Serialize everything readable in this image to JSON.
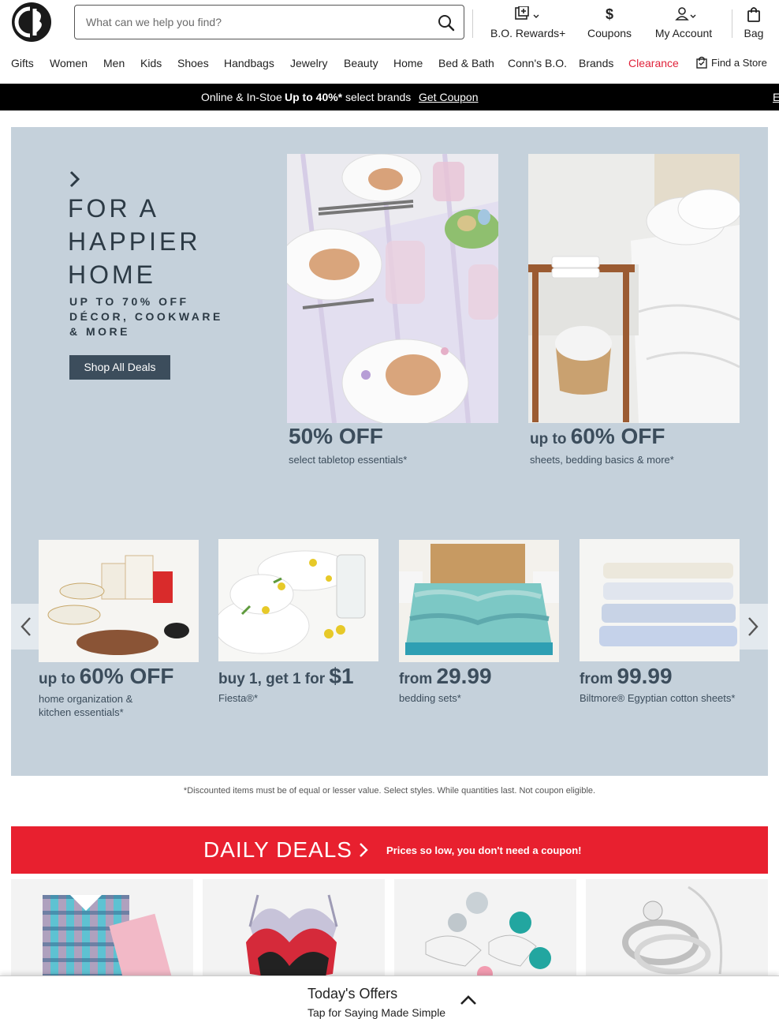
{
  "header": {
    "search_placeholder": "What can we help you find?",
    "rewards_label": "B.O. Rewards+",
    "coupons_label": "Coupons",
    "account_label": "My Account",
    "bag_label": "Bag"
  },
  "nav": {
    "items": [
      "Gifts",
      "Women",
      "Men",
      "Kids",
      "Shoes",
      "Handbags",
      "Jewelry",
      "Beauty",
      "Home",
      "Bed & Bath",
      "Conn's B.O.",
      "Brands",
      "Clearance"
    ],
    "find_store": "Find a Store"
  },
  "promo": {
    "text1": "Online & In-Stoe",
    "bold": "Up to 40%*",
    "text2": "select brands",
    "link": "Get Coupon",
    "edge": "E"
  },
  "hero": {
    "title": [
      "FOR A",
      "HAPPIER",
      "HOME"
    ],
    "subtitle": [
      "UP TO 70% OFF",
      "DÉCOR, COOKWARE",
      "& MORE"
    ],
    "cta": "Shop All Deals",
    "features": [
      {
        "prefix": "",
        "big": "50% OFF",
        "caption": "select tabletop essentials*"
      },
      {
        "prefix": "up to ",
        "big": "60% OFF",
        "caption": "sheets, bedding basics & more*"
      }
    ],
    "tiles": [
      {
        "prefix": "up to ",
        "big": "60% OFF",
        "caption": [
          "home organization &",
          "kitchen essentials*"
        ]
      },
      {
        "prefix": "buy 1, get 1 for ",
        "big": "$1",
        "caption": [
          "Fiesta®*"
        ]
      },
      {
        "prefix": "from ",
        "big": "29.99",
        "caption": [
          "bedding sets*"
        ]
      },
      {
        "prefix": "from ",
        "big": "99.99",
        "caption": [
          "Biltmore® Egyptian cotton sheets*"
        ]
      }
    ]
  },
  "disclaimer": "*Discounted items must be of equal or lesser value. Select styles. While quantities last. Not coupon eligible.",
  "daily_deals": {
    "title": "DAILY DEALS",
    "subtitle": "Prices so low, you don't need a coupon!"
  },
  "offers": {
    "title": "Today's Offers",
    "subtitle": "Tap for Saying Made Simple"
  },
  "colors": {
    "hero_bg": "#c5d1db",
    "hero_text": "#3c4d5c",
    "deals_red": "#e8202f",
    "clearance_red": "#e0223a"
  }
}
